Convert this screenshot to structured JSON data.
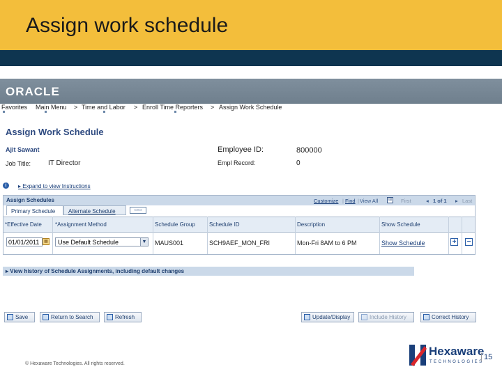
{
  "slide": {
    "title": "Assign work schedule",
    "copyright": "© Hexaware Technologies. All rights reserved.",
    "page_number": "15",
    "logo_text": "Hexaware",
    "logo_sub": "TECHNOLOGIES"
  },
  "app": {
    "brand": "ORACLE",
    "nav": {
      "favorites": "Favorites",
      "main_menu": "Main Menu",
      "sep": ">",
      "time_labor": "Time and Labor",
      "enroll": "Enroll Time Reporters",
      "current": "Assign Work Schedule"
    },
    "page_title": "Assign Work Schedule",
    "employee": {
      "name": "Ajit Sawant",
      "job_title_label": "Job Title:",
      "job_title": "IT Director",
      "employee_id_label": "Employee ID:",
      "employee_id": "800000",
      "empl_record_label": "Empl Record:",
      "empl_record": "0"
    },
    "expand_instructions": "Expand to view Instructions",
    "grid": {
      "title": "Assign Schedules",
      "customize": "Customize",
      "find": "Find",
      "view_all": "View All",
      "first": "First",
      "page_info": "1 of 1",
      "last": "Last",
      "tabs": [
        "Primary Schedule",
        "Alternate Schedule"
      ],
      "columns": [
        "*Effective Date",
        "*Assignment Method",
        "Schedule Group",
        "Schedule ID",
        "Description",
        "Show Schedule"
      ],
      "row": {
        "effective_date": "01/01/2011",
        "assignment_method": "Use Default Schedule",
        "schedule_group": "MAUS001",
        "schedule_id": "SCH9AEF_MON_FRI",
        "description": "Mon-Fri 8AM to 6 PM",
        "show_schedule": "Show Schedule"
      }
    },
    "history_bar": "View history of Schedule Assignments, including default changes",
    "buttons": {
      "save": "Save",
      "return_search": "Return to Search",
      "refresh": "Refresh",
      "update_display": "Update/Display",
      "include_history": "Include History",
      "correct_history": "Correct History"
    }
  }
}
